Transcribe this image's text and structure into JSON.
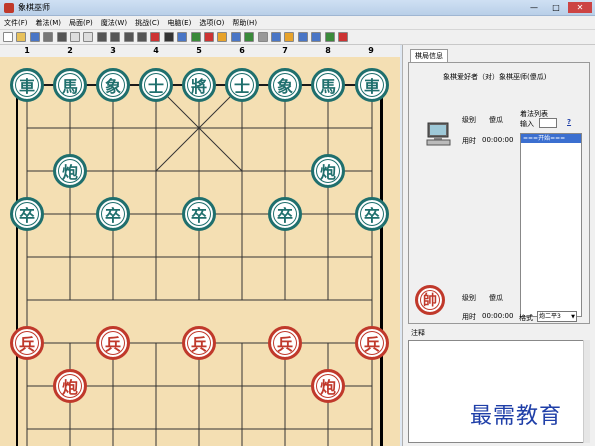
{
  "window": {
    "title": "象棋巫师",
    "controls": [
      "—",
      "□",
      "✕"
    ]
  },
  "menu": [
    "文件(F)",
    "着法(M)",
    "局面(P)",
    "魔法(W)",
    "挑战(C)",
    "电脑(E)",
    "选项(O)",
    "帮助(H)"
  ],
  "toolbar": {
    "icons": [
      "new-icon",
      "open-icon",
      "save-icon",
      "print-icon",
      "undo-icon",
      "copy-icon",
      "paste-icon",
      "first-move-icon",
      "prev-move-icon",
      "next-move-icon",
      "last-move-icon",
      "cut-icon",
      "find-icon",
      "book-icon",
      "flag-icon",
      "engine-icon",
      "hint-icon",
      "setup-icon",
      "music-icon",
      "sound-icon",
      "rotate-icon",
      "timer-icon",
      "clock-icon",
      "help-icon",
      "info-icon",
      "exit-icon"
    ]
  },
  "board": {
    "file_numbers": [
      "1",
      "2",
      "3",
      "4",
      "5",
      "6",
      "7",
      "8",
      "9"
    ],
    "black_back": [
      "車",
      "馬",
      "象",
      "士",
      "將",
      "士",
      "象",
      "馬",
      "車"
    ],
    "black_cannons": [
      "炮",
      "炮"
    ],
    "black_pawns": [
      "卒",
      "卒",
      "卒",
      "卒",
      "卒"
    ],
    "red_pawns": [
      "兵",
      "兵",
      "兵",
      "兵",
      "兵"
    ],
    "red_cannons": [
      "炮",
      "炮"
    ],
    "colors": {
      "board": "#f4dfb3",
      "black": "#1f6f6d",
      "red": "#c0392b"
    }
  },
  "panel": {
    "tab": "棋局信息",
    "matchup": "象棋爱好者（对）象棋巫师(傻瓜)",
    "top_player": {
      "level_label": "级别",
      "level_value": "傻瓜",
      "time_label": "用时",
      "time_value": "00:00:00"
    },
    "bottom_player": {
      "avatar_char": "帥",
      "level_label": "级别",
      "level_value": "傻瓜",
      "time_label": "用时",
      "time_value": "00:00:00"
    },
    "movelist": {
      "title": "着法列表",
      "input_label": "输入",
      "help_link": "?",
      "start_item": "===开始==="
    },
    "format": {
      "label": "格式",
      "selected": "炮二平3"
    },
    "notes_label": "注释"
  },
  "watermark": "最需教育"
}
